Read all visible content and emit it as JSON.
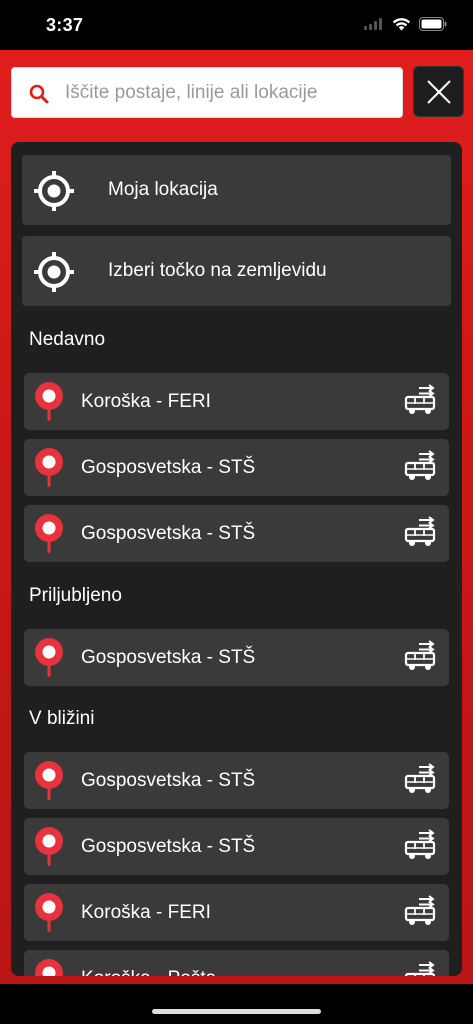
{
  "status": {
    "time": "3:37"
  },
  "search": {
    "placeholder": "Iščite postaje, linije ali lokacije"
  },
  "actions": [
    {
      "label": "Moja lokacija",
      "icon": "crosshair-icon"
    },
    {
      "label": "Izberi točko na zemljevidu",
      "icon": "crosshair-icon"
    }
  ],
  "sections": {
    "recent": {
      "title": "Nedavno",
      "items": [
        {
          "label": "Koroška - FERI"
        },
        {
          "label": "Gosposvetska - STŠ"
        },
        {
          "label": "Gosposvetska - STŠ"
        }
      ]
    },
    "favorites": {
      "title": "Priljubljeno",
      "items": [
        {
          "label": "Gosposvetska - STŠ"
        }
      ]
    },
    "nearby": {
      "title": "V bližini",
      "items": [
        {
          "label": "Gosposvetska - STŠ"
        },
        {
          "label": "Gosposvetska - STŠ"
        },
        {
          "label": "Koroška - FERI"
        },
        {
          "label": "Koroška - Pošta"
        }
      ]
    }
  },
  "colors": {
    "accent": "#e01d1d",
    "panel": "#1f1f1f",
    "row": "#3a3a3a",
    "pin": "#e8323c"
  }
}
